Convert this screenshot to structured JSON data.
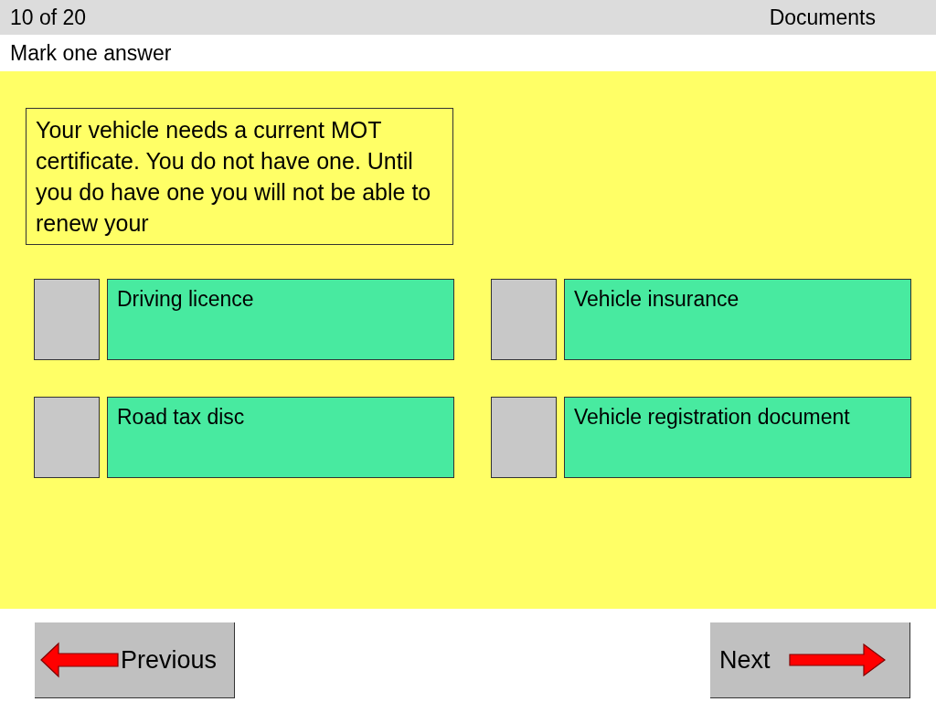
{
  "header": {
    "progress": "10 of 20",
    "category": "Documents"
  },
  "instruction": "Mark one answer",
  "question": "Your vehicle needs a current MOT certificate.  You do not have one. Until you do have one you will not be able to renew your",
  "answers": [
    {
      "label": "Driving licence",
      "checked": false
    },
    {
      "label": "Vehicle insurance",
      "checked": false
    },
    {
      "label": "Road tax disc",
      "checked": false
    },
    {
      "label": "Vehicle registration document",
      "checked": false
    }
  ],
  "navigation": {
    "previous": "Previous",
    "next": "Next"
  }
}
